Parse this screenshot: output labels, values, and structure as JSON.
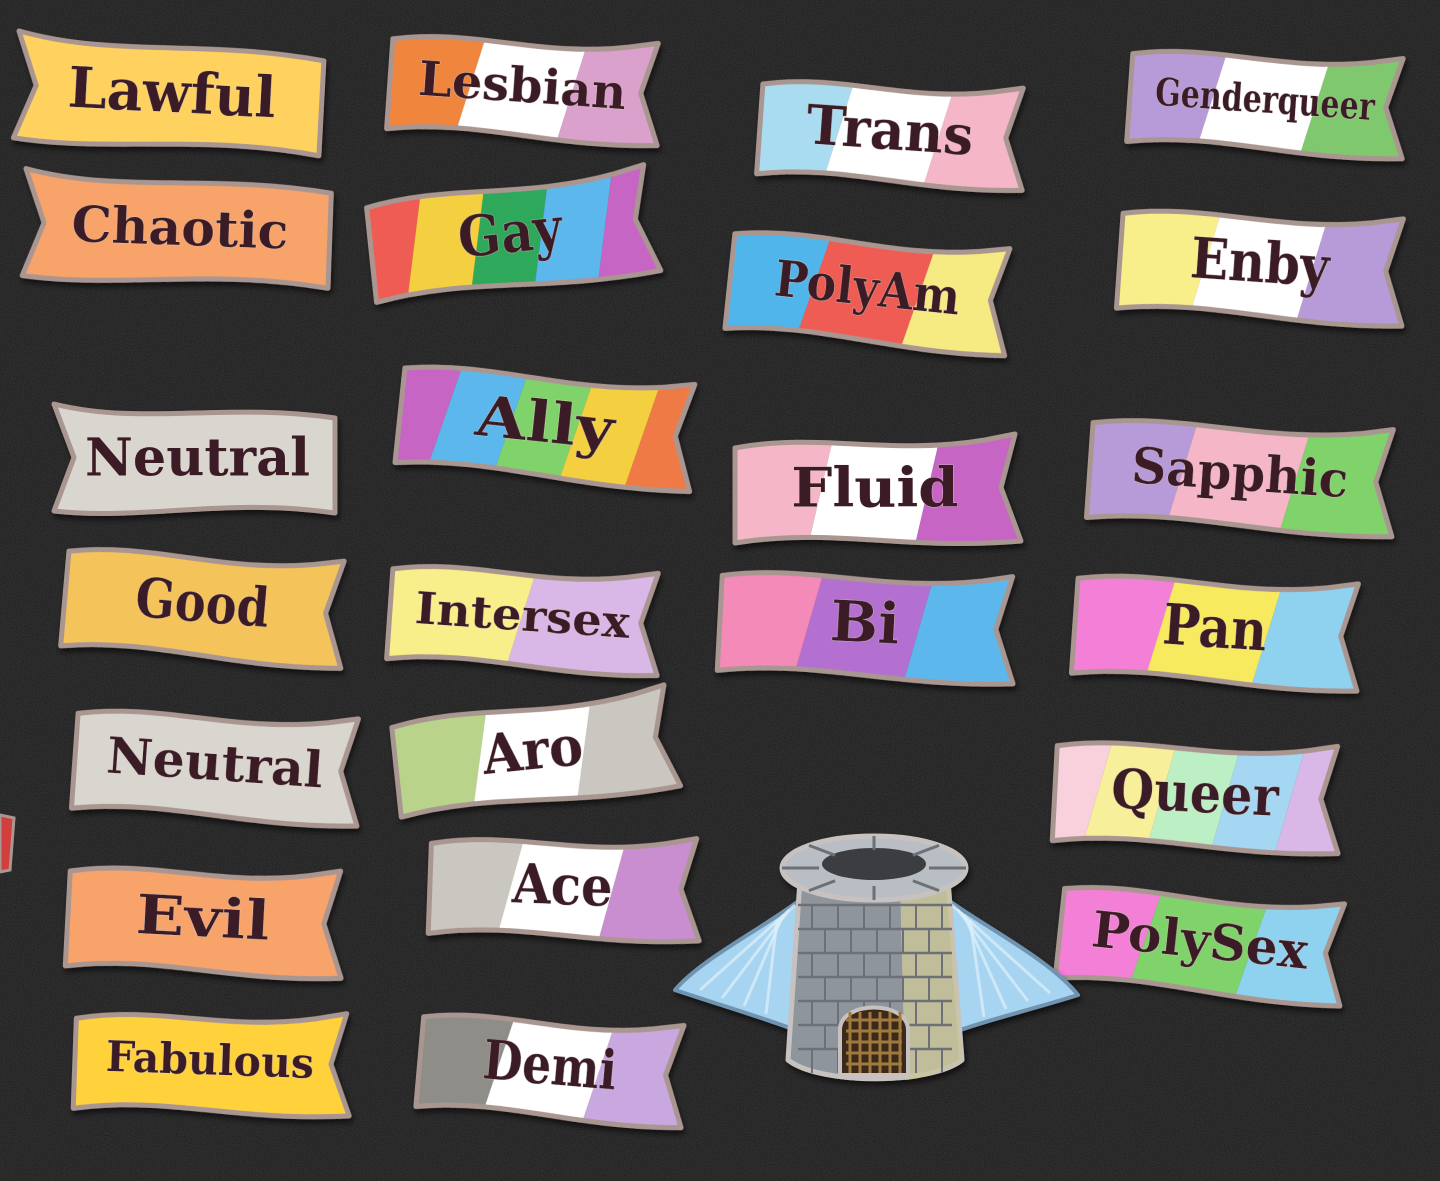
{
  "scene": {
    "background": "#1b1a1a",
    "outline_color": "#a99690",
    "text_color": "#3a1f26"
  },
  "banners": [
    {
      "label": "Lawful",
      "stripes": [
        "#ffd25f"
      ]
    },
    {
      "label": "Lesbian",
      "stripes": [
        "#f0863e",
        "#ffffff",
        "#d9a1cc"
      ]
    },
    {
      "label": "Trans",
      "stripes": [
        "#a9dcf0",
        "#ffffff",
        "#f5b6c8"
      ]
    },
    {
      "label": "Genderqueer",
      "stripes": [
        "#b79ad8",
        "#ffffff",
        "#7fc86e"
      ]
    },
    {
      "label": "Chaotic",
      "stripes": [
        "#f7a36a"
      ]
    },
    {
      "label": "Gay",
      "stripes": [
        "#ef5b52",
        "#f4d03f",
        "#2ea85a",
        "#5cb7ec",
        "#c665c4"
      ]
    },
    {
      "label": "PolyAm",
      "stripes": [
        "#4fb5ea",
        "#ef5b52",
        "#f6ea82"
      ]
    },
    {
      "label": "Enby",
      "stripes": [
        "#f8ef8a",
        "#ffffff",
        "#b79ad8"
      ]
    },
    {
      "label": "Neutral",
      "stripes": [
        "#d9d6cf"
      ]
    },
    {
      "label": "Ally",
      "stripes": [
        "#c665c4",
        "#5cb7ec",
        "#7fd36a",
        "#f4d03f",
        "#f07a45"
      ]
    },
    {
      "label": "Fluid",
      "stripes": [
        "#f5b6c8",
        "#ffffff",
        "#c665c4"
      ]
    },
    {
      "label": "Sapphic",
      "stripes": [
        "#b79ad8",
        "#f5b6c8",
        "#7fd36a"
      ]
    },
    {
      "label": "Good",
      "stripes": [
        "#f4c35a"
      ]
    },
    {
      "label": "Intersex",
      "stripes": [
        "#f8ef8a",
        "#d9b8e8"
      ]
    },
    {
      "label": "Bi",
      "stripes": [
        "#f48ab8",
        "#b46fd0",
        "#5cb7ec"
      ]
    },
    {
      "label": "Pan",
      "stripes": [
        "#f47fd6",
        "#f8ea5e",
        "#8fd2ef"
      ]
    },
    {
      "label": "Neutral",
      "stripes": [
        "#d9d6cf"
      ]
    },
    {
      "label": "Aro",
      "stripes": [
        "#b9d48a",
        "#ffffff",
        "#c9c7bf"
      ]
    },
    {
      "label": "Queer",
      "stripes": [
        "#f8d1dc",
        "#f8ef9a",
        "#bdefc4",
        "#a5d7f2",
        "#d9b8e8"
      ]
    },
    {
      "label": "Ace",
      "stripes": [
        "#c9c7bf",
        "#ffffff",
        "#c98ed0"
      ]
    },
    {
      "label": "Evil",
      "stripes": [
        "#f7a36a"
      ]
    },
    {
      "label": "PolySex",
      "stripes": [
        "#f47fd6",
        "#7fd36a",
        "#8fd2ef"
      ]
    },
    {
      "label": "Fabulous",
      "stripes": [
        "#ffd23a"
      ]
    },
    {
      "label": "Demi",
      "stripes": [
        "#8f8d88",
        "#ffffff",
        "#c9a8e0"
      ]
    }
  ],
  "tower_pin": {
    "stone_color": "#8e959c",
    "stone_light": "#b8bec3",
    "stone_accent": "#c9c59a",
    "wing_color": "#a7d4f0",
    "door_color": "#a07a3c"
  }
}
